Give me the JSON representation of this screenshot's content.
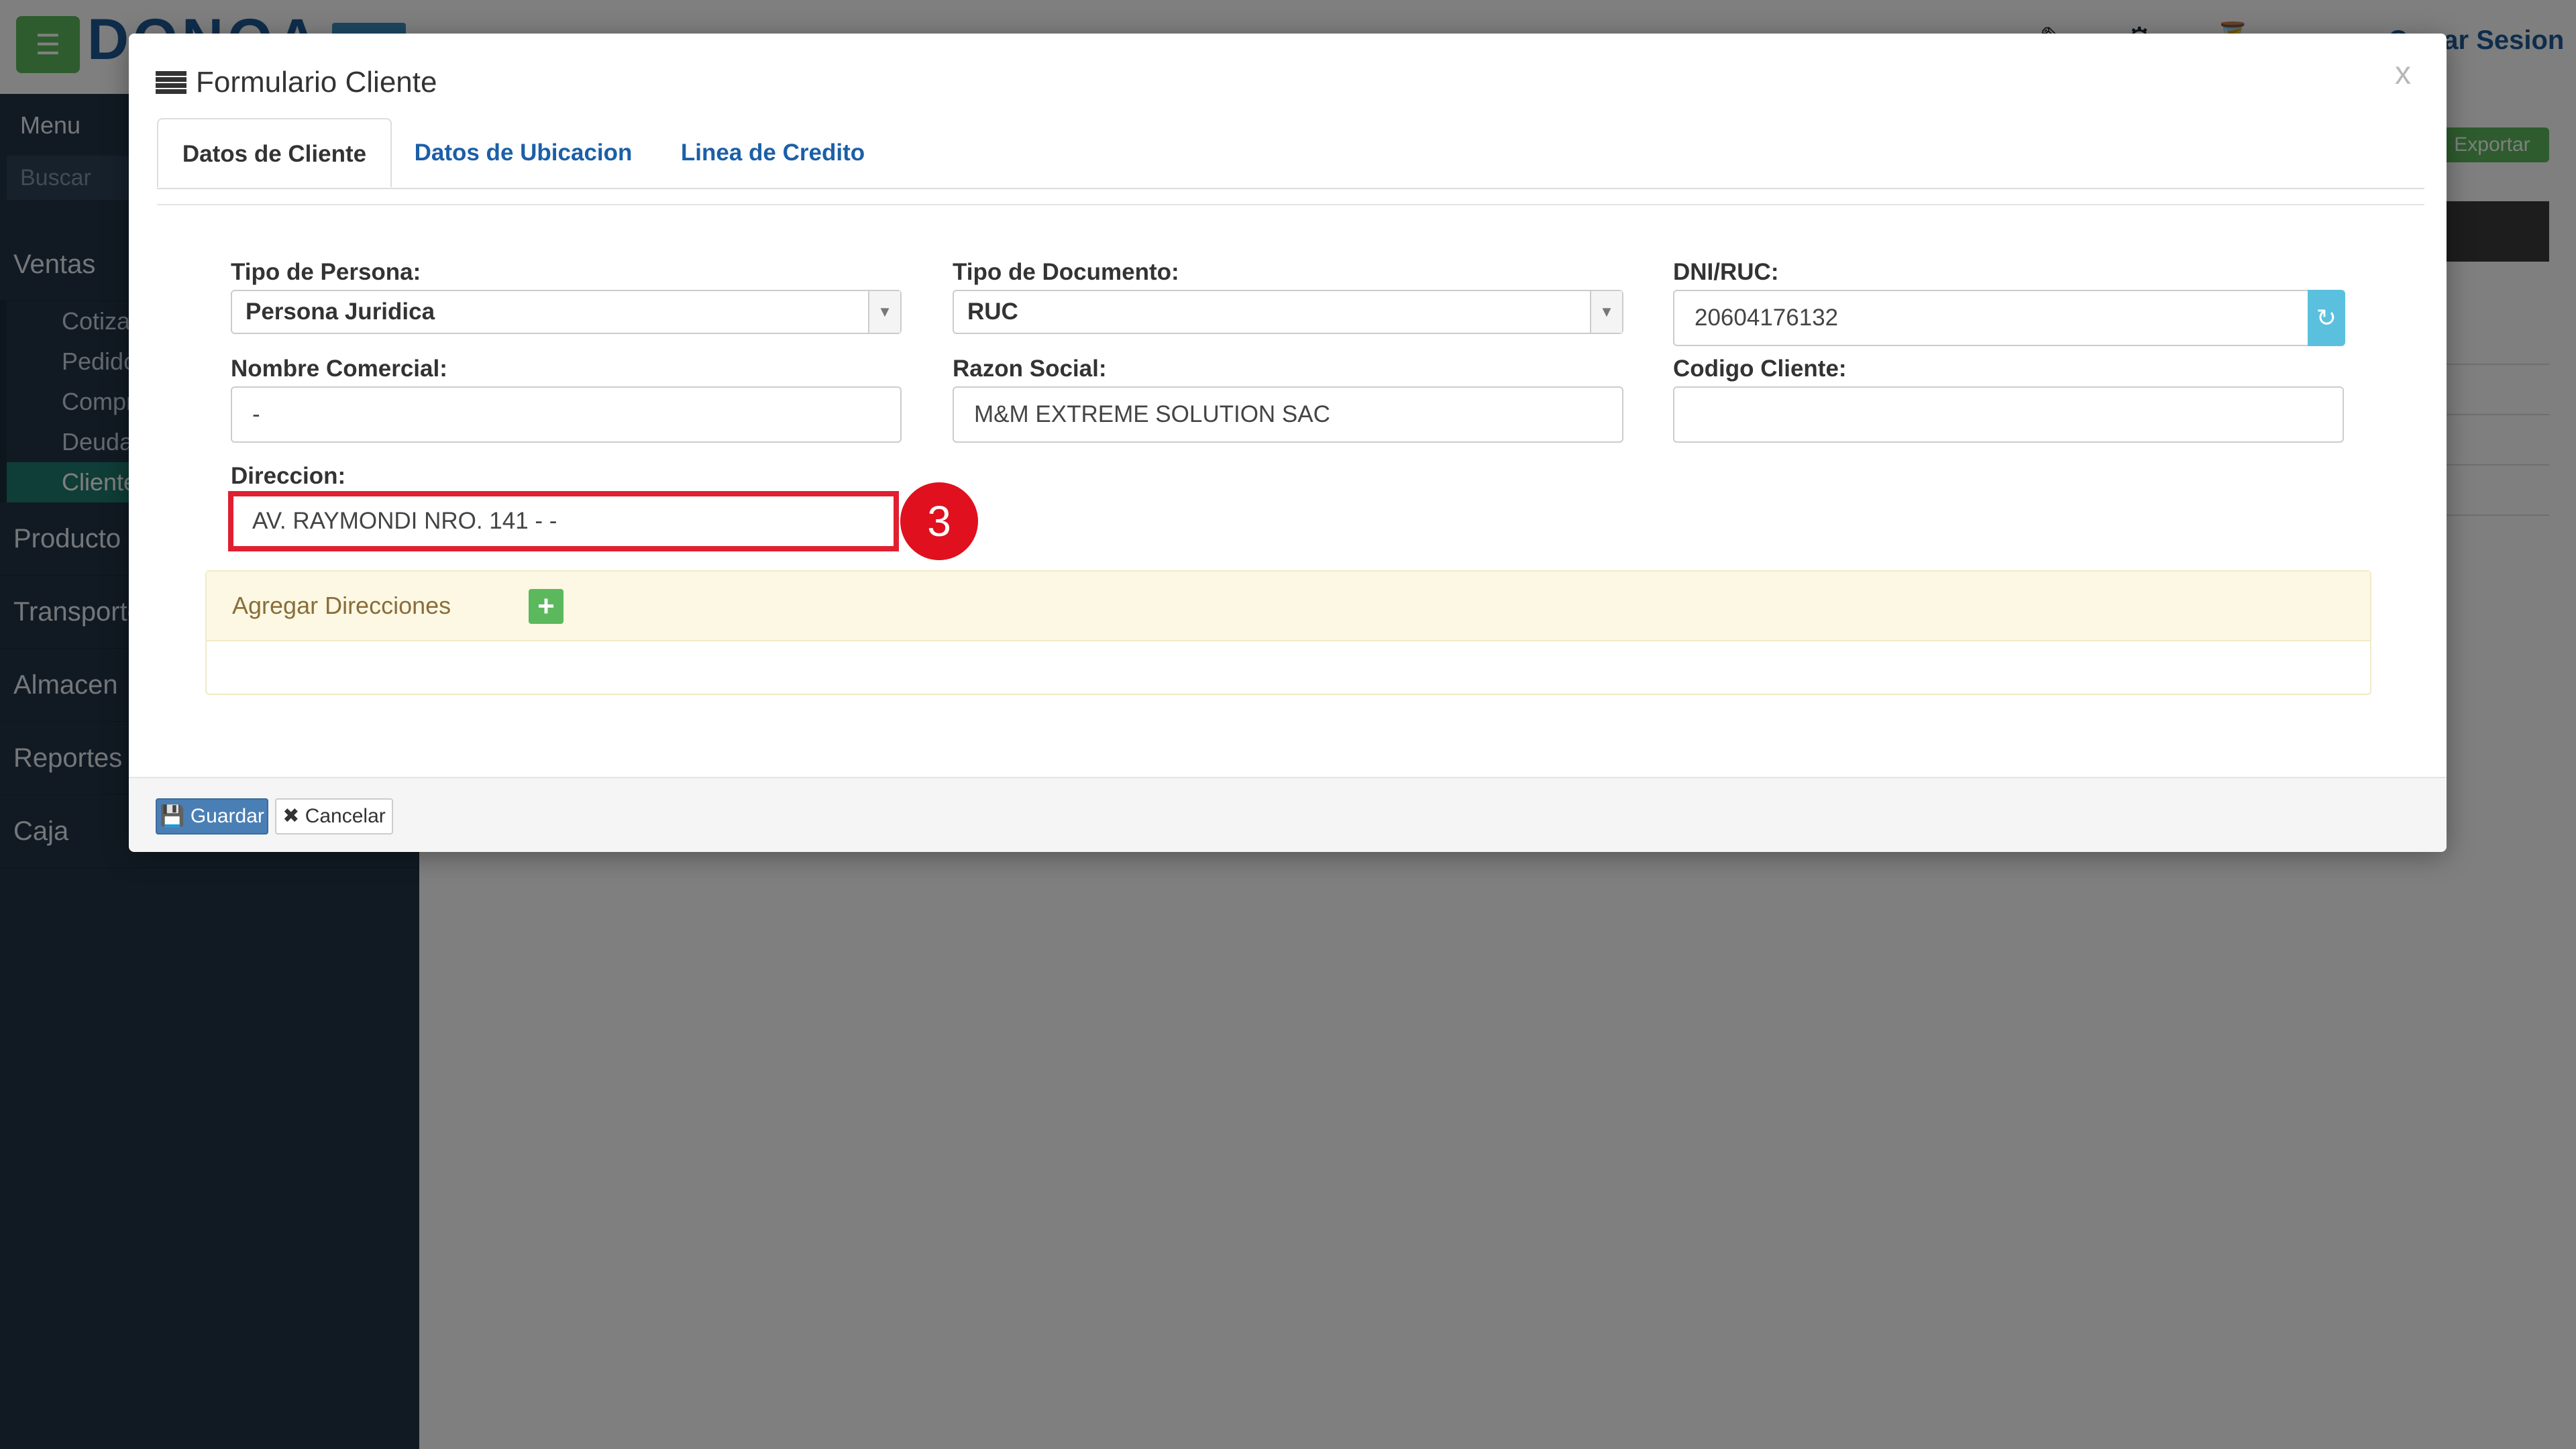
{
  "background": {
    "menu_label": "Menu",
    "search_placeholder": "Buscar",
    "export_label": "Exportar",
    "logout_label": "Cerrar Sesion",
    "sidebar_items": [
      "Ventas",
      "Producto",
      "Transporte",
      "Almacen",
      "Reportes",
      "Caja"
    ],
    "ventas_subitems": [
      "Cotizaciones",
      "Pedidos",
      "Compras",
      "Deudas",
      "Clientes"
    ],
    "brand": "DONOA"
  },
  "modal": {
    "title": "Formulario Cliente",
    "close": "x",
    "tabs": [
      "Datos de Cliente",
      "Datos de Ubicacion",
      "Linea de Credito"
    ],
    "fields": {
      "tipo_persona_label": "Tipo de Persona:",
      "tipo_persona_value": "Persona Juridica",
      "tipo_documento_label": "Tipo de Documento:",
      "tipo_documento_value": "RUC",
      "dni_ruc_label": "DNI/RUC:",
      "dni_ruc_value": "20604176132",
      "nombre_comercial_label": "Nombre Comercial:",
      "nombre_comercial_value": "-",
      "razon_social_label": "Razon Social:",
      "razon_social_value": "M&M EXTREME SOLUTION SAC",
      "codigo_cliente_label": "Codigo Cliente:",
      "codigo_cliente_value": "",
      "direccion_label": "Direccion:",
      "direccion_value": "AV. RAYMONDI NRO. 141 - -"
    },
    "step_badge": "3",
    "panel_title": "Agregar Direcciones",
    "buttons": {
      "save": "Guardar",
      "cancel": "Cancelar"
    }
  },
  "colors": {
    "accent_green": "#5cb85c",
    "link_blue": "#1b5fa8",
    "highlight_red": "#e02030",
    "sidebar_bg": "#223447"
  }
}
